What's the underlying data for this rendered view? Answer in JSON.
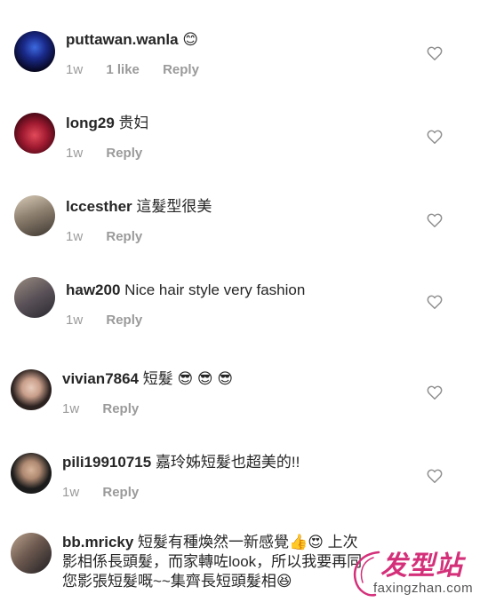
{
  "comments": [
    {
      "username": "puttawan.wanla",
      "text": "",
      "emojis": "😊",
      "time": "1w",
      "likes": "1 like",
      "reply": "Reply",
      "avatar_colors": [
        "#0a0a3a",
        "#2d58c8"
      ]
    },
    {
      "username": "long29",
      "text": "贵妇",
      "emojis": "",
      "time": "1w",
      "likes": "",
      "reply": "Reply",
      "avatar_colors": [
        "#4a0a1a",
        "#c0304a"
      ]
    },
    {
      "username": "lccesther",
      "text": "這髮型很美",
      "emojis": "",
      "time": "1w",
      "likes": "",
      "reply": "Reply",
      "avatar_colors": [
        "#6b6258",
        "#c9b9a3"
      ]
    },
    {
      "username": "haw200",
      "text": "Nice hair style very fashion",
      "emojis": "",
      "time": "1w",
      "likes": "",
      "reply": "Reply",
      "avatar_colors": [
        "#3c3a44",
        "#8a7d74"
      ]
    },
    {
      "username": "vivian7864",
      "text": "短髮",
      "emojis": "😎 😎 😎",
      "time": "1w",
      "likes": "",
      "reply": "Reply",
      "avatar_colors": [
        "#2c2220",
        "#d9b8a8"
      ]
    },
    {
      "username": "pili19910715",
      "text": "嘉玲姊短髮也超美的!!",
      "emojis": "",
      "time": "1w",
      "likes": "",
      "reply": "Reply",
      "avatar_colors": [
        "#1e1e1e",
        "#c7a88e"
      ]
    },
    {
      "username": "bb.mricky",
      "text_line1": "短髮有種煥然一新感覺👍😍 上次",
      "text_line2": "影相係長頭髮，而家轉咗look，所以我要再同",
      "text_line3": "您影張短髮嘅~~集齊長短頭髮相😆",
      "avatar_colors": [
        "#2a2a2a",
        "#b49a88"
      ]
    }
  ],
  "watermark": {
    "title": "发型站",
    "url": "faxingzhan.com",
    "color": "#d4307a"
  },
  "icons": {
    "like": "heart-outline-icon"
  }
}
